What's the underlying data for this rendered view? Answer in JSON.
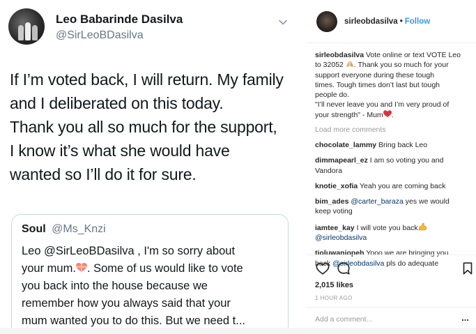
{
  "tweet": {
    "name": "Leo Babarinde Dasilva",
    "handle": "@SirLeoBDasilva",
    "lines": [
      "If I’m voted back, I will return. My family",
      "and I deliberated on this today.",
      "Thank you all so much for the support,",
      "I know it’s what she would have",
      "wanted so I’ll do it for sure."
    ],
    "quote": {
      "name": "Soul",
      "handle": "@Ms_Knzi",
      "lines": [
        "Leo @SirLeoBDasilva , I'm  so sorry about",
        "your mum.",
        ". Some of us would  like to vote",
        "you back into the house because  we",
        "remember  how you always  said that your",
        "mum wanted you to do this.  But we need t..."
      ]
    }
  },
  "instagram": {
    "username": "sirleobdasilva",
    "separator": "•",
    "follow": "Follow",
    "caption_user": "sirleobdasilva",
    "caption_lines": [
      "Vote online or text VOTE Leo",
      "to 32052",
      ". Thank you so much for your",
      "support everyone during these tough",
      "times. Tough times don’t last but tough",
      "people do.",
      "\"I’ll never leave you and I’m very proud of",
      "your strength\" - Mum",
      "."
    ],
    "load_more": "Load more comments",
    "comments": [
      {
        "user": "chocolate_lammy",
        "lines": [
          "Bring back Leo"
        ]
      },
      {
        "user": "dimmapearl_ez",
        "lines": [
          "I am so voting you and",
          "Vandora"
        ]
      },
      {
        "user": "knotie_xofia",
        "lines": [
          "Yeah you are coming back"
        ]
      },
      {
        "user": "bim_ades",
        "mention": "@carter_baraza",
        "lines": [
          "yes we would",
          "keep voting"
        ]
      },
      {
        "user": "iamtee_kay",
        "mention": "@sirleobdasilva",
        "lines": [
          "I will vote you back"
        ]
      },
      {
        "user": "tioluwaniopeh",
        "mention": "@sirleobdasilva",
        "lines": [
          "Yooo we are bringing you",
          "back",
          "pls do adequate"
        ]
      }
    ],
    "likes": "2,015 likes",
    "time": "1 HOUR AGO",
    "add_comment_placeholder": "Add a comment...",
    "more_options": "..."
  },
  "colors": {
    "twitter_text": "#14171a",
    "twitter_secondary": "#657786",
    "instagram_blue": "#3897f0",
    "instagram_mention": "#003569",
    "instagram_grey": "#999999",
    "heart_red": "#ed4956"
  },
  "icons": [
    "chevron-down-icon",
    "heart-gift-emoji-icon",
    "praying-hands-emoji-icon",
    "red-heart-emoji-icon",
    "flexed-biceps-emoji-icon",
    "like-heart-icon",
    "comment-bubble-icon",
    "bookmark-icon"
  ]
}
